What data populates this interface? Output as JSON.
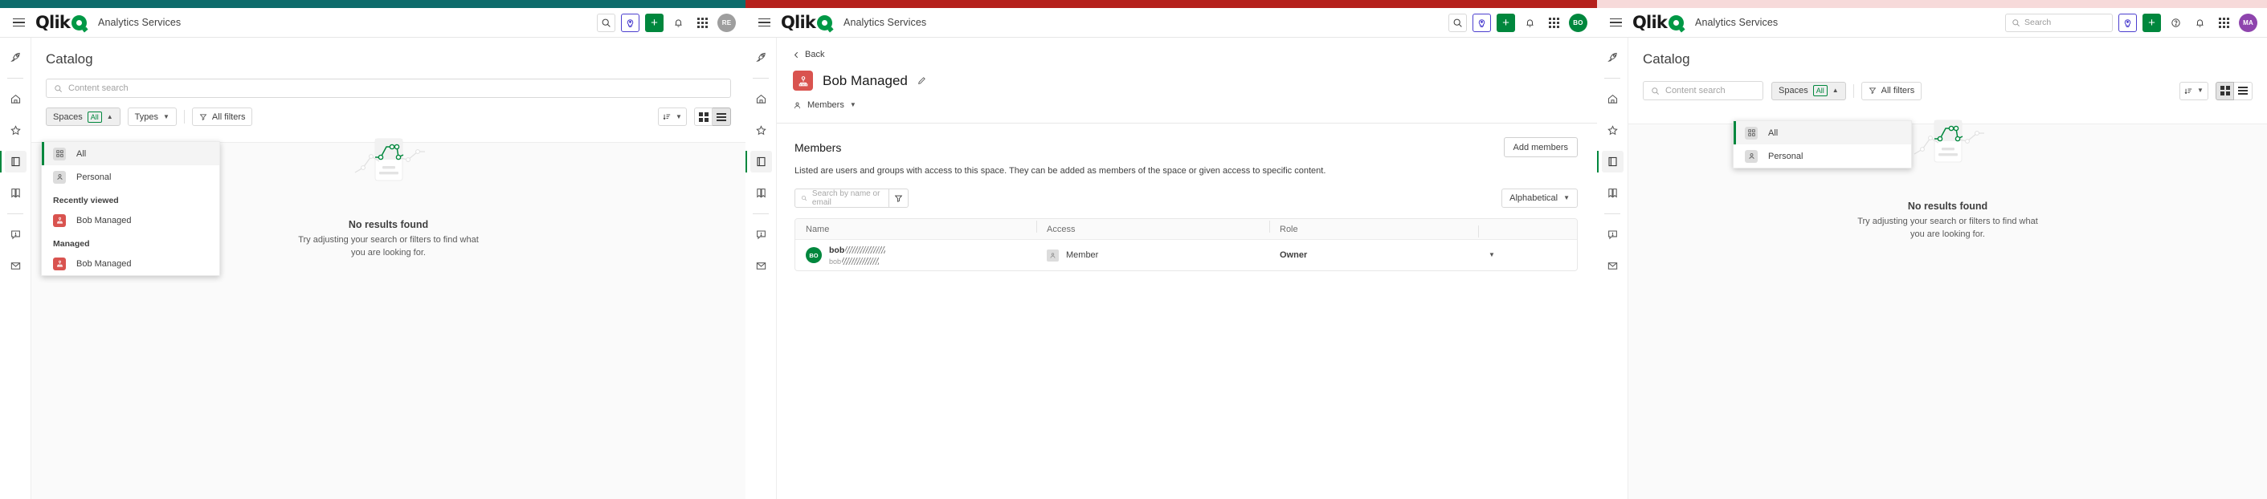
{
  "panels": [
    {
      "id": "panel-catalog-spaces-open",
      "accent_color": "#0e6b6b",
      "navbar": {
        "logo_text": "Qlik",
        "tenant": "Analytics Services",
        "avatar_initials": "RE",
        "avatar_color": "#9e9e9e",
        "icons": [
          "menu-icon",
          "search-icon",
          "insight-advisor-icon",
          "create-icon",
          "notifications-icon",
          "app-launcher-icon",
          "avatar"
        ]
      },
      "rail_items": [
        "rocket-icon",
        "home-icon",
        "favorites-icon",
        "catalog-icon",
        "collections-icon",
        "alerts-icon",
        "subscriptions-icon"
      ],
      "rail_active_index": 3,
      "page_title": "Catalog",
      "search": {
        "placeholder": "Content search",
        "value": ""
      },
      "filters": {
        "spaces_label": "Spaces",
        "spaces_badge": "All",
        "types_label": "Types",
        "all_filters_label": "All filters"
      },
      "spaces_dropdown": {
        "open": true,
        "items": [
          {
            "label": "All",
            "icon": "all-spaces-icon",
            "selected": true,
            "kind": "item"
          },
          {
            "label": "Personal",
            "icon": "personal-space-icon",
            "selected": false,
            "kind": "item"
          },
          {
            "label": "Recently viewed",
            "kind": "group"
          },
          {
            "label": "Bob Managed",
            "icon": "managed-space-icon",
            "selected": false,
            "kind": "item"
          },
          {
            "label": "Managed",
            "kind": "group"
          },
          {
            "label": "Bob Managed",
            "icon": "managed-space-icon",
            "selected": false,
            "kind": "item"
          }
        ]
      },
      "empty_state": {
        "title": "No results found",
        "subtitle": "Try adjusting your search or filters to find what you are looking for."
      },
      "view_mode": "list"
    },
    {
      "id": "panel-space-members",
      "accent_color": "#b5201c",
      "navbar": {
        "logo_text": "Qlik",
        "tenant": "Analytics Services",
        "avatar_initials": "BO",
        "avatar_color": "#00873d"
      },
      "rail_items": [
        "rocket-icon",
        "home-icon",
        "favorites-icon",
        "catalog-icon",
        "collections-icon",
        "alerts-icon",
        "subscriptions-icon"
      ],
      "rail_active_index": 3,
      "back_label": "Back",
      "space_title": "Bob Managed",
      "tabs": [
        {
          "label": "Members"
        }
      ],
      "members": {
        "heading": "Members",
        "add_button": "Add members",
        "description": "Listed are users and groups with access to this space. They can be added as members of the space or given access to specific content.",
        "search_placeholder": "Search by name or email",
        "sort_label": "Alphabetical",
        "columns": [
          "Name",
          "Access",
          "Role",
          ""
        ],
        "rows": [
          {
            "avatar_initials": "BO",
            "name": "bob",
            "name_redacted": true,
            "sub_redacted": true,
            "access": "Member",
            "role": "Owner"
          }
        ]
      }
    },
    {
      "id": "panel-catalog-spaces-open-2",
      "accent_color": "#f7dada",
      "navbar": {
        "logo_text": "Qlik",
        "tenant": "Analytics Services",
        "avatar_initials": "MA",
        "avatar_color": "#8e44ad",
        "search_placeholder": "Search"
      },
      "rail_items": [
        "rocket-icon",
        "home-icon",
        "favorites-icon",
        "catalog-icon",
        "collections-icon",
        "alerts-icon",
        "subscriptions-icon"
      ],
      "rail_active_index": 3,
      "page_title": "Catalog",
      "search": {
        "placeholder": "Content search",
        "value": ""
      },
      "filters": {
        "spaces_label": "Spaces",
        "spaces_badge": "All",
        "all_filters_label": "All filters"
      },
      "spaces_dropdown": {
        "open": true,
        "items": [
          {
            "label": "All",
            "icon": "all-spaces-icon",
            "selected": true,
            "kind": "item"
          },
          {
            "label": "Personal",
            "icon": "personal-space-icon",
            "selected": false,
            "kind": "item"
          }
        ]
      },
      "empty_state": {
        "title": "No results found",
        "subtitle": "Try adjusting your search or filters to find what you are looking for."
      },
      "view_mode": "grid"
    }
  ]
}
